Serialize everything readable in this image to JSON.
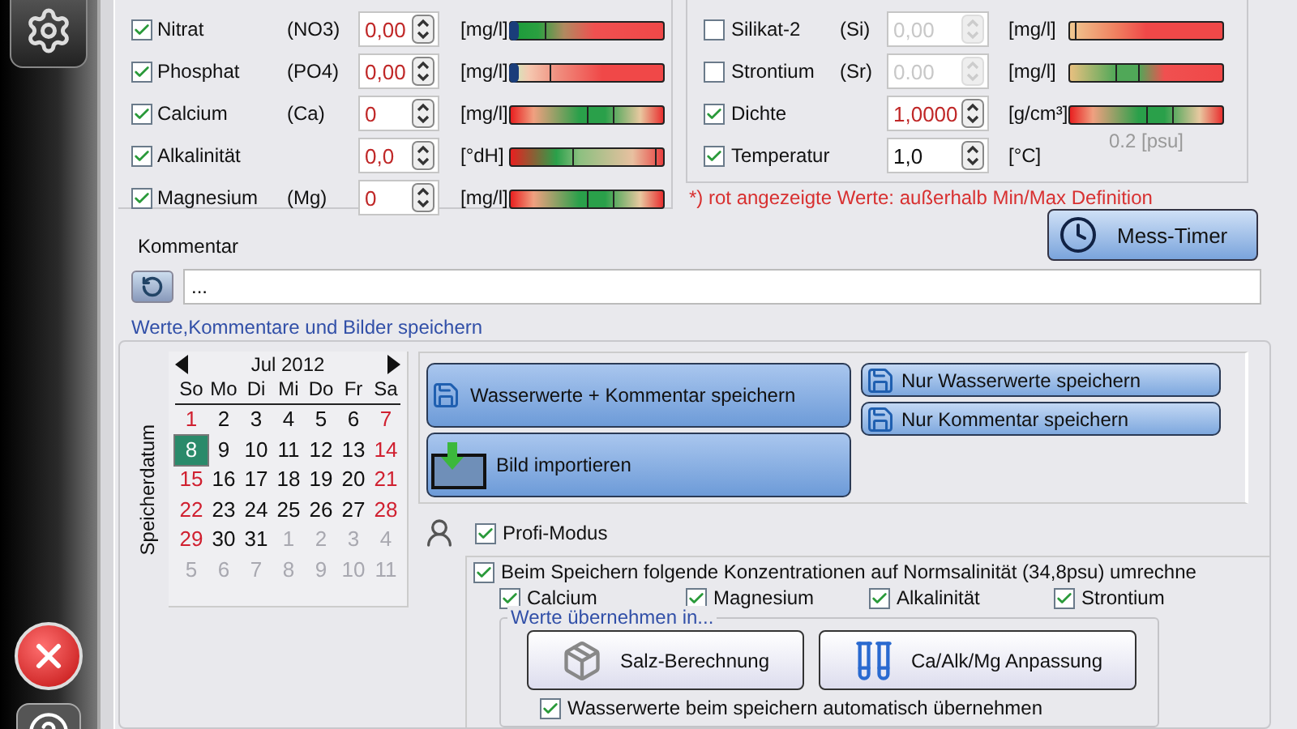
{
  "parameters_left": [
    {
      "label": "Nitrat",
      "formula": "(NO3)",
      "checked": true,
      "value": "0,00",
      "out_of_range": true,
      "unit": "[mg/l]",
      "kind": "lowgreen",
      "level": 0
    },
    {
      "label": "Phosphat",
      "formula": "(PO4)",
      "checked": true,
      "value": "0,00",
      "out_of_range": true,
      "unit": "[mg/l]",
      "kind": "lowpale",
      "level": 0
    },
    {
      "label": "Calcium",
      "formula": "(Ca)",
      "checked": true,
      "value": "0",
      "out_of_range": true,
      "unit": "[mg/l]",
      "kind": "midgreen"
    },
    {
      "label": "Alkalinität",
      "checked": true,
      "value": "0,0",
      "out_of_range": true,
      "unit": "[°dH]",
      "kind": "midleft"
    },
    {
      "label": "Magnesium",
      "formula": "(Mg)",
      "checked": true,
      "value": "0",
      "out_of_range": true,
      "unit": "[mg/l]",
      "kind": "midgreen"
    }
  ],
  "parameters_right": [
    {
      "label": "Silikat-2",
      "formula": "(Si)",
      "checked": false,
      "value": "0,00",
      "out_of_range": false,
      "unit": "[mg/l]",
      "kind": "lowtan"
    },
    {
      "label": "Strontium",
      "formula": "(Sr)",
      "checked": false,
      "value": "0.00",
      "out_of_range": false,
      "unit": "[mg/l]",
      "kind": "midtan"
    },
    {
      "label": "Dichte",
      "checked": true,
      "value": "1,0000",
      "out_of_range": true,
      "unit": "[g/cm³]",
      "kind": "midgreen",
      "note": "0.2 [psu]"
    },
    {
      "label": "Temperatur",
      "checked": true,
      "value": "1,0",
      "out_of_range": false,
      "unit": "[°C]",
      "kind": "plain"
    }
  ],
  "range_note": "*) rot angezeigte Werte: außerhalb Min/Max Definition",
  "timer_button": "Mess-Timer",
  "comment": {
    "label": "Kommentar",
    "value": "..."
  },
  "save_group": {
    "title": "Werte,Kommentare und Bilder speichern",
    "calendar": {
      "side_label": "Speicherdatum",
      "month": "Jul 2012",
      "weekdays": [
        "So",
        "Mo",
        "Di",
        "Mi",
        "Do",
        "Fr",
        "Sa"
      ],
      "weeks": [
        [
          {
            "day": "1",
            "kind": "weekend"
          },
          {
            "day": "2",
            "kind": "normal"
          },
          {
            "day": "3",
            "kind": "normal"
          },
          {
            "day": "4",
            "kind": "normal"
          },
          {
            "day": "5",
            "kind": "normal"
          },
          {
            "day": "6",
            "kind": "normal"
          },
          {
            "day": "7",
            "kind": "weekend"
          }
        ],
        [
          {
            "day": "8",
            "kind": "selected"
          },
          {
            "day": "9",
            "kind": "normal"
          },
          {
            "day": "10",
            "kind": "normal"
          },
          {
            "day": "11",
            "kind": "normal"
          },
          {
            "day": "12",
            "kind": "normal"
          },
          {
            "day": "13",
            "kind": "normal"
          },
          {
            "day": "14",
            "kind": "weekend"
          }
        ],
        [
          {
            "day": "15",
            "kind": "weekend"
          },
          {
            "day": "16",
            "kind": "normal"
          },
          {
            "day": "17",
            "kind": "normal"
          },
          {
            "day": "18",
            "kind": "normal"
          },
          {
            "day": "19",
            "kind": "normal"
          },
          {
            "day": "20",
            "kind": "normal"
          },
          {
            "day": "21",
            "kind": "weekend"
          }
        ],
        [
          {
            "day": "22",
            "kind": "weekend"
          },
          {
            "day": "23",
            "kind": "normal"
          },
          {
            "day": "24",
            "kind": "normal"
          },
          {
            "day": "25",
            "kind": "normal"
          },
          {
            "day": "26",
            "kind": "normal"
          },
          {
            "day": "27",
            "kind": "normal"
          },
          {
            "day": "28",
            "kind": "weekend"
          }
        ],
        [
          {
            "day": "29",
            "kind": "weekend"
          },
          {
            "day": "30",
            "kind": "normal"
          },
          {
            "day": "31",
            "kind": "normal"
          },
          {
            "day": "1",
            "kind": "other"
          },
          {
            "day": "2",
            "kind": "other"
          },
          {
            "day": "3",
            "kind": "other"
          },
          {
            "day": "4",
            "kind": "other"
          }
        ],
        [
          {
            "day": "5",
            "kind": "other"
          },
          {
            "day": "6",
            "kind": "other"
          },
          {
            "day": "7",
            "kind": "other"
          },
          {
            "day": "8",
            "kind": "other"
          },
          {
            "day": "9",
            "kind": "other"
          },
          {
            "day": "10",
            "kind": "other"
          },
          {
            "day": "11",
            "kind": "other"
          }
        ]
      ]
    },
    "big_buttons": [
      "Wasserwerte + Kommentar speichern",
      "Bild importieren"
    ],
    "small_buttons": [
      "Nur Wasserwerte speichern",
      "Nur Kommentar speichern"
    ],
    "profi_mode": {
      "label": "Profi-Modus",
      "checked": true
    },
    "conversion": {
      "label": "Beim Speichern folgende Konzentrationen auf Normsalinität (34,8psu) umrechne",
      "checked": true,
      "options": [
        {
          "label": "Calcium",
          "checked": true
        },
        {
          "label": "Magnesium",
          "checked": true
        },
        {
          "label": "Alkalinität",
          "checked": true
        },
        {
          "label": "Strontium",
          "checked": true
        }
      ],
      "transfer": {
        "title": "Werte übernehmen in...",
        "buttons": [
          "Salz-Berechnung",
          "Ca/Alk/Mg Anpassung"
        ],
        "auto": {
          "label": "Wasserwerte beim speichern automatisch übernehmen",
          "checked": true
        }
      }
    }
  }
}
